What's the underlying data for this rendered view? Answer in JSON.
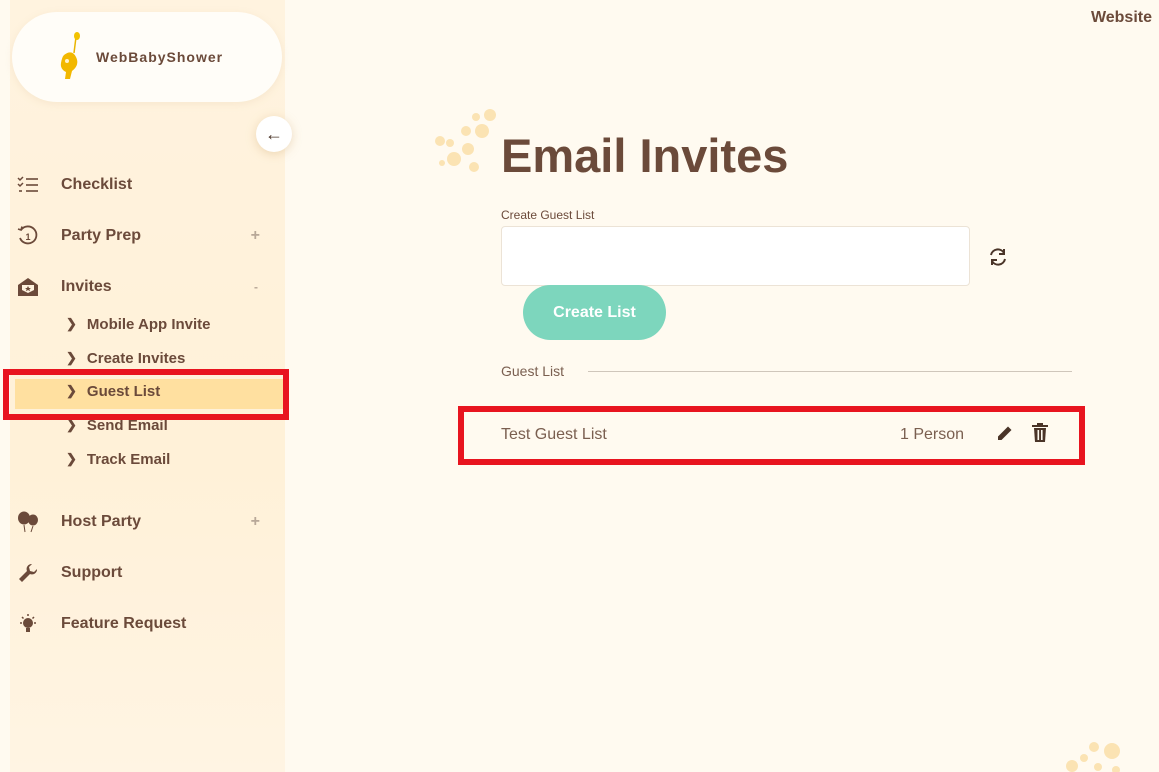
{
  "brand": {
    "name": "WebBabyShower"
  },
  "header": {
    "website_link": "Website"
  },
  "sidebar": {
    "items": [
      {
        "label": "Checklist",
        "icon": "checklist-icon"
      },
      {
        "label": "Party Prep",
        "icon": "history-clock-icon",
        "expand": "+"
      },
      {
        "label": "Invites",
        "icon": "envelope-open-icon",
        "expand": "-"
      },
      {
        "label": "Host Party",
        "icon": "balloons-icon",
        "expand": "+"
      },
      {
        "label": "Support",
        "icon": "wrench-icon"
      },
      {
        "label": "Feature Request",
        "icon": "lightbulb-icon"
      }
    ],
    "invites_sub": [
      {
        "label": "Mobile App Invite"
      },
      {
        "label": "Create Invites"
      },
      {
        "label": "Guest List",
        "active": true
      },
      {
        "label": "Send Email"
      },
      {
        "label": "Track Email"
      }
    ]
  },
  "main": {
    "title": "Email Invites",
    "create_label": "Create Guest List",
    "create_value": "",
    "create_button": "Create List",
    "section_label": "Guest List",
    "lists": [
      {
        "name": "Test Guest List",
        "count": "1 Person"
      }
    ]
  },
  "colors": {
    "accent_button": "#7dd6bd",
    "text_brown": "#6b4a3a",
    "highlight": "#e8141f",
    "active_bg": "#ffe0a0",
    "background": "#fffaf0"
  }
}
